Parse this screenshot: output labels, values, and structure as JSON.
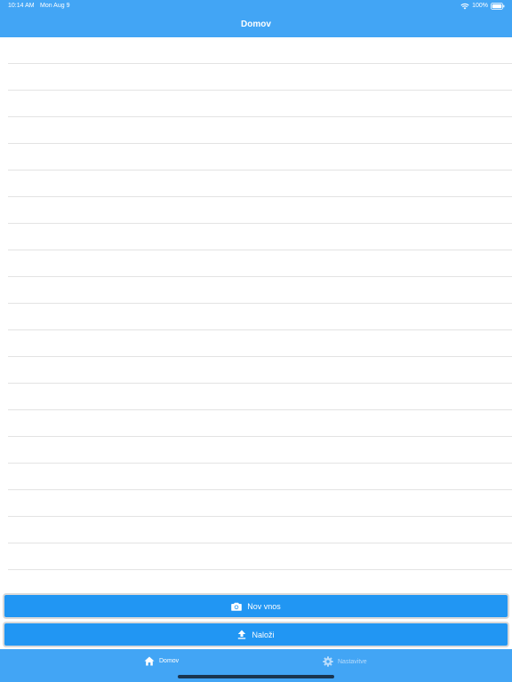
{
  "status_bar": {
    "time": "10:14 AM",
    "date": "Mon Aug 9",
    "battery_percent": "100%",
    "wifi_icon": "wifi-icon",
    "battery_icon": "battery-icon"
  },
  "nav": {
    "title": "Domov"
  },
  "list": {
    "row_count": 21
  },
  "actions": {
    "new_entry": {
      "label": "Nov vnos",
      "icon": "camera-icon"
    },
    "upload": {
      "label": "Naloži",
      "icon": "upload-icon"
    }
  },
  "tabbar": {
    "tabs": [
      {
        "label": "Domov",
        "icon": "home-icon",
        "selected": true
      },
      {
        "label": "Nastavitve",
        "icon": "gear-icon",
        "selected": false
      }
    ]
  },
  "colors": {
    "header": "#42a5f5",
    "button": "#2196f3",
    "separator": "#e3e3e3",
    "tab_active": "#ffffff",
    "tab_inactive": "#b9dcfb"
  }
}
